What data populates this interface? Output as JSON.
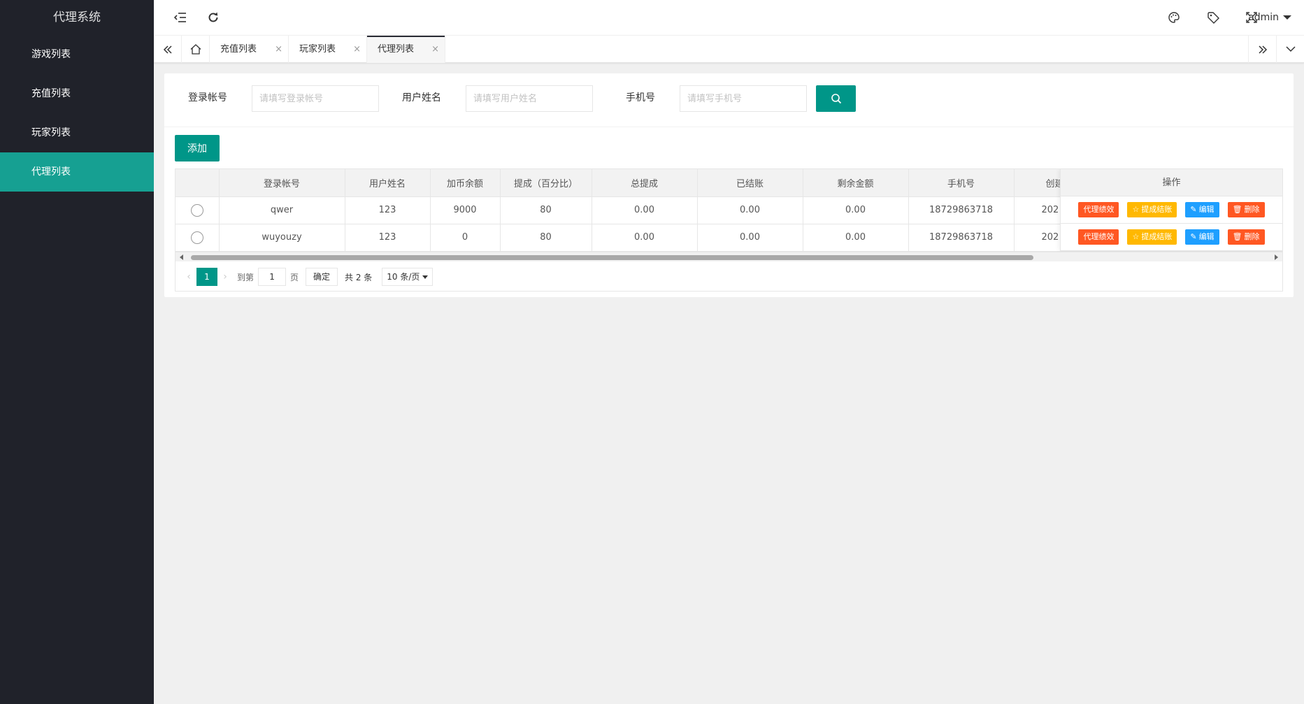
{
  "app": {
    "title": "代理系统"
  },
  "sidebar": {
    "items": [
      {
        "label": "游戏列表",
        "active": false
      },
      {
        "label": "充值列表",
        "active": false
      },
      {
        "label": "玩家列表",
        "active": false
      },
      {
        "label": "代理列表",
        "active": true
      }
    ]
  },
  "header": {
    "user": "admin",
    "icons": [
      "menu-fold-icon",
      "refresh-icon",
      "theme-icon",
      "tag-icon",
      "fullscreen-icon"
    ]
  },
  "tabs": {
    "items": [
      {
        "label": "充值列表",
        "active": false
      },
      {
        "label": "玩家列表",
        "active": false
      },
      {
        "label": "代理列表",
        "active": true
      }
    ],
    "close_glyph": "×"
  },
  "search": {
    "account_label": "登录帐号",
    "account_placeholder": "请填写登录帐号",
    "name_label": "用户姓名",
    "name_placeholder": "请填写用户姓名",
    "phone_label": "手机号",
    "phone_placeholder": "请填写手机号"
  },
  "toolbar": {
    "add_label": "添加"
  },
  "table": {
    "columns": [
      "登录帐号",
      "用户姓名",
      "加币余额",
      "提成（百分比）",
      "总提成",
      "已结账",
      "剩余金额",
      "手机号",
      "创建"
    ],
    "ops_header": "操作",
    "rows": [
      {
        "account": "qwer",
        "name": "123",
        "balance": "9000",
        "rate": "80",
        "total": "0.00",
        "settled": "0.00",
        "remain": "0.00",
        "phone": "18729863718",
        "created": "202"
      },
      {
        "account": "wuyouzy",
        "name": "123",
        "balance": "0",
        "rate": "80",
        "total": "0.00",
        "settled": "0.00",
        "remain": "0.00",
        "phone": "18729863718",
        "created": "202"
      }
    ],
    "ops": {
      "performance": "代理绩效",
      "settle": "提成结账",
      "edit": "编辑",
      "delete": "删除"
    }
  },
  "pager": {
    "current": "1",
    "goto_label": "到第",
    "page_input": "1",
    "page_unit": "页",
    "confirm": "确定",
    "total": "共 2 条",
    "page_size": "10 条/页"
  },
  "colors": {
    "sidebar_bg": "#20222a",
    "accent": "#009688",
    "danger": "#ff5722",
    "warn": "#ffb800",
    "info": "#1e9fff"
  }
}
